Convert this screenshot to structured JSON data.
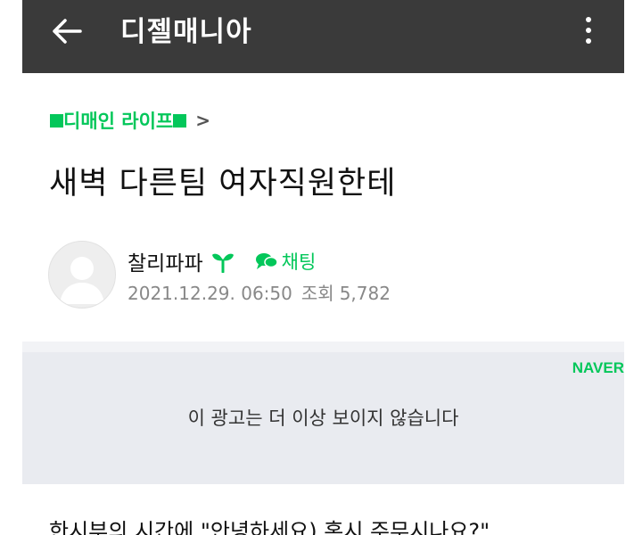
{
  "appbar": {
    "title": "디젤매니아",
    "back_icon": "arrow-left-icon",
    "more_icon": "more-vertical-icon",
    "background": "#3a3a3a"
  },
  "post": {
    "board": "디매인 라이프",
    "board_chevron": ">",
    "title": "새벽 다른팀 여자직원한테",
    "author": "찰리파파",
    "author_badge_icon": "sprout-icon",
    "chat_label": "채팅",
    "date": "2021.12.29. 06:50",
    "views_label": "조회",
    "views": "5,782",
    "body_preview": "한시부의 시간에 \"안녕하세요) 혹시 주무시나요?\""
  },
  "ad": {
    "brand": "NAVER",
    "message": "이 광고는 더 이상 보이지 않습니다"
  },
  "colors": {
    "accent": "#03c75a",
    "ad_background": "#e9ebf0"
  }
}
